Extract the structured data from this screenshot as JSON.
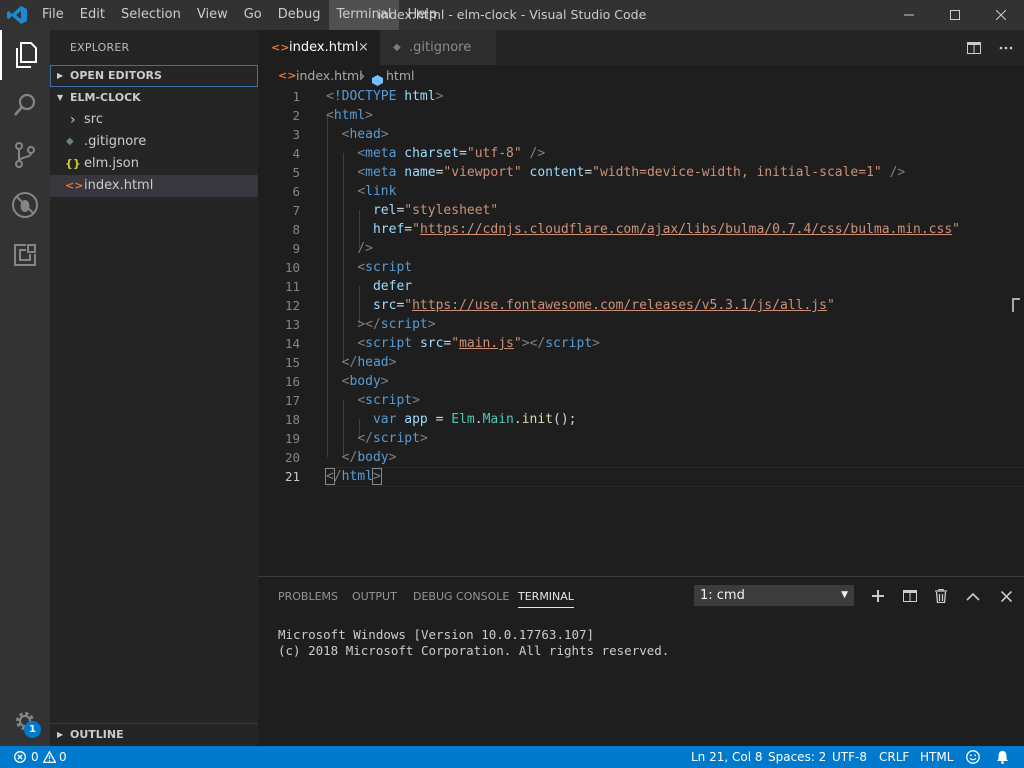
{
  "window": {
    "title": "index.html - elm-clock - Visual Studio Code"
  },
  "menus": [
    "File",
    "Edit",
    "Selection",
    "View",
    "Go",
    "Debug",
    "Terminal",
    "Help"
  ],
  "activity_bar": {
    "icons": [
      "files-icon",
      "search-icon",
      "source-control-icon",
      "debug-icon",
      "extensions-icon"
    ],
    "settings_badge": "1"
  },
  "sidebar": {
    "title": "EXPLORER",
    "open_editors": "OPEN EDITORS",
    "project": "ELM-CLOCK",
    "files": [
      {
        "name": "src",
        "icon": "›"
      },
      {
        "name": ".gitignore",
        "icon": "◆"
      },
      {
        "name": "elm.json",
        "icon": "{}"
      },
      {
        "name": "index.html",
        "icon": "<>"
      }
    ],
    "outline": "OUTLINE"
  },
  "tabs": [
    {
      "label": "index.html",
      "icon": "<>",
      "close": "×"
    },
    {
      "label": ".gitignore",
      "icon": "◆"
    }
  ],
  "breadcrumb": {
    "file": "index.html",
    "separator": "›",
    "element": "html"
  },
  "editor": {
    "line_numbers": [
      "1",
      "2",
      "3",
      "4",
      "5",
      "6",
      "7",
      "8",
      "9",
      "10",
      "11",
      "12",
      "13",
      "14",
      "15",
      "16",
      "17",
      "18",
      "19",
      "20",
      "21"
    ],
    "active_line": "21"
  },
  "panel": {
    "tabs": [
      "PROBLEMS",
      "OUTPUT",
      "DEBUG CONSOLE",
      "TERMINAL"
    ],
    "active_tab": "TERMINAL",
    "terminal_select": "1: cmd",
    "terminal_lines": [
      "Microsoft Windows [Version 10.0.17763.107]",
      "(c) 2018 Microsoft Corporation. All rights reserved."
    ]
  },
  "statusbar": {
    "errors": "0",
    "warnings": "0",
    "position": "Ln 21, Col 8",
    "spaces": "Spaces: 2",
    "encoding": "UTF-8",
    "eol": "CRLF",
    "language": "HTML",
    "feedback_icon": "smiley-icon",
    "bell_icon": "bell-icon"
  },
  "colors": {
    "accent": "#007acc",
    "activity_bar": "#333333",
    "sidebar": "#252526",
    "editor": "#1e1e1e"
  }
}
